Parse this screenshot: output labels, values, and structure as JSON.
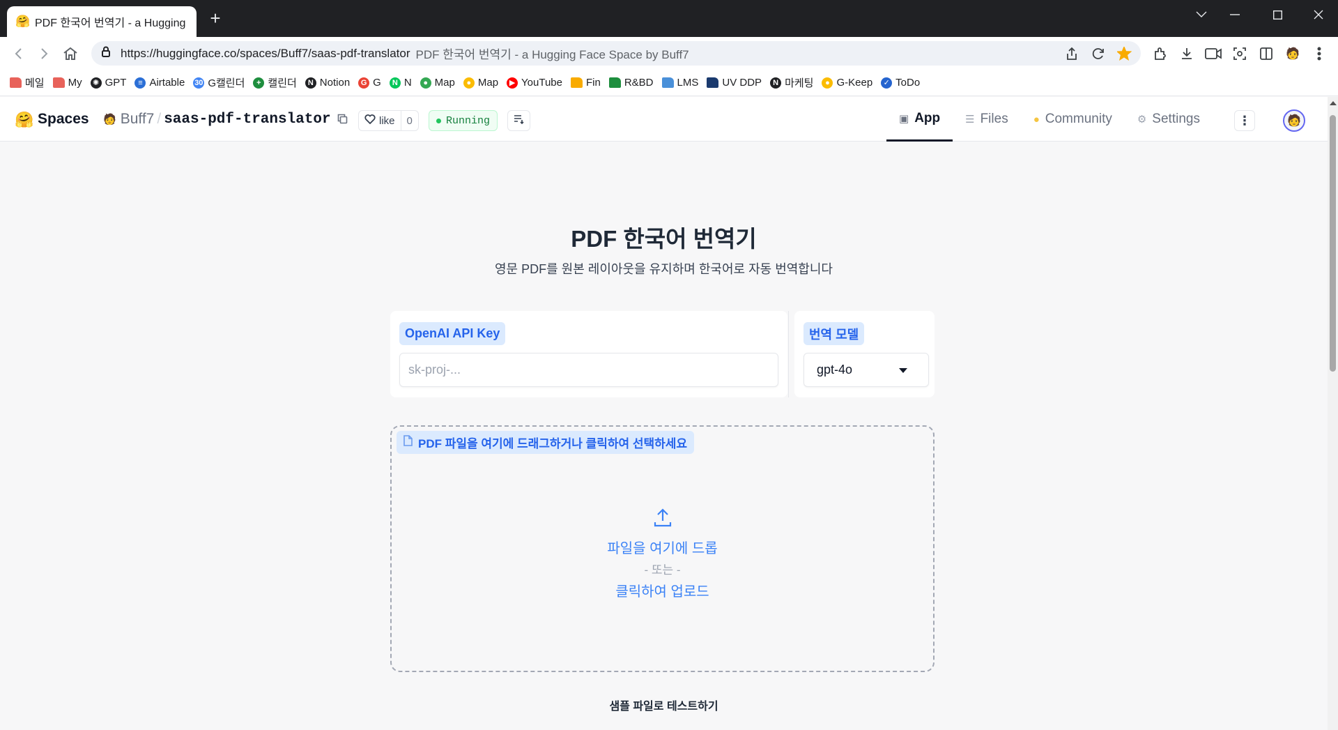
{
  "browser": {
    "tab_title": "PDF 한국어 번역기 - a Hugging Face Space by Buff7",
    "new_tab": "+",
    "url": "https://huggingface.co/spaces/Buff7/saas-pdf-translator",
    "url_title": "PDF 한국어 번역기 - a Hugging Face Space by Buff7",
    "bookmarks": [
      {
        "label": "메일",
        "icon": "folder",
        "color": "#e8625a"
      },
      {
        "label": "My",
        "icon": "folder",
        "color": "#e8625a"
      },
      {
        "label": "GPT",
        "icon": "openai",
        "color": "#202124"
      },
      {
        "label": "Airtable",
        "icon": "airtable",
        "color": "#2b6fd6"
      },
      {
        "label": "G캘린더",
        "icon": "calendar",
        "color": "#4285f4"
      },
      {
        "label": "캘린더",
        "icon": "plus",
        "color": "#1e8e3e"
      },
      {
        "label": "Notion",
        "icon": "notion",
        "color": "#202124"
      },
      {
        "label": "G",
        "icon": "google",
        "color": "#ea4335"
      },
      {
        "label": "N",
        "icon": "naver",
        "color": "#03c75a"
      },
      {
        "label": "Map",
        "icon": "map-pin",
        "color": "#34a853"
      },
      {
        "label": "Map",
        "icon": "map-pin",
        "color": "#fbbc04"
      },
      {
        "label": "YouTube",
        "icon": "youtube",
        "color": "#ff0000"
      },
      {
        "label": "Fin",
        "icon": "folder",
        "color": "#f9ab00"
      },
      {
        "label": "R&BD",
        "icon": "folder",
        "color": "#1e8e3e"
      },
      {
        "label": "LMS",
        "icon": "folder",
        "color": "#4a90d9"
      },
      {
        "label": "UV DDP",
        "icon": "folder",
        "color": "#1a3a6e"
      },
      {
        "label": "마케팅",
        "icon": "notion",
        "color": "#202124"
      },
      {
        "label": "G-Keep",
        "icon": "keep",
        "color": "#fbbc04"
      },
      {
        "label": "ToDo",
        "icon": "check",
        "color": "#2564cf"
      }
    ]
  },
  "hf": {
    "brand": "Spaces",
    "owner": "Buff7",
    "repo": "saas-pdf-translator",
    "like_label": "like",
    "like_count": "0",
    "status": "Running",
    "tabs": [
      {
        "label": "App",
        "icon": "cube-icon",
        "active": true
      },
      {
        "label": "Files",
        "icon": "files-icon",
        "active": false
      },
      {
        "label": "Community",
        "icon": "community-icon",
        "active": false
      },
      {
        "label": "Settings",
        "icon": "gear-icon",
        "active": false
      }
    ]
  },
  "app": {
    "title": "PDF 한국어 번역기",
    "subtitle": "영문 PDF를 원본 레이아웃을 유지하며 한국어로 자동 번역합니다",
    "api_key": {
      "label": "OpenAI API Key",
      "placeholder": "sk-proj-...",
      "value": ""
    },
    "model": {
      "label": "번역 모델",
      "value": "gpt-4o"
    },
    "upload": {
      "label": "PDF 파일을 여기에 드래그하거나 클릭하여 선택하세요",
      "drop_text": "파일을 여기에 드롭",
      "or_text": "- 또는 -",
      "click_text": "클릭하여 업로드"
    },
    "sample_label": "샘플 파일로 테스트하기"
  }
}
